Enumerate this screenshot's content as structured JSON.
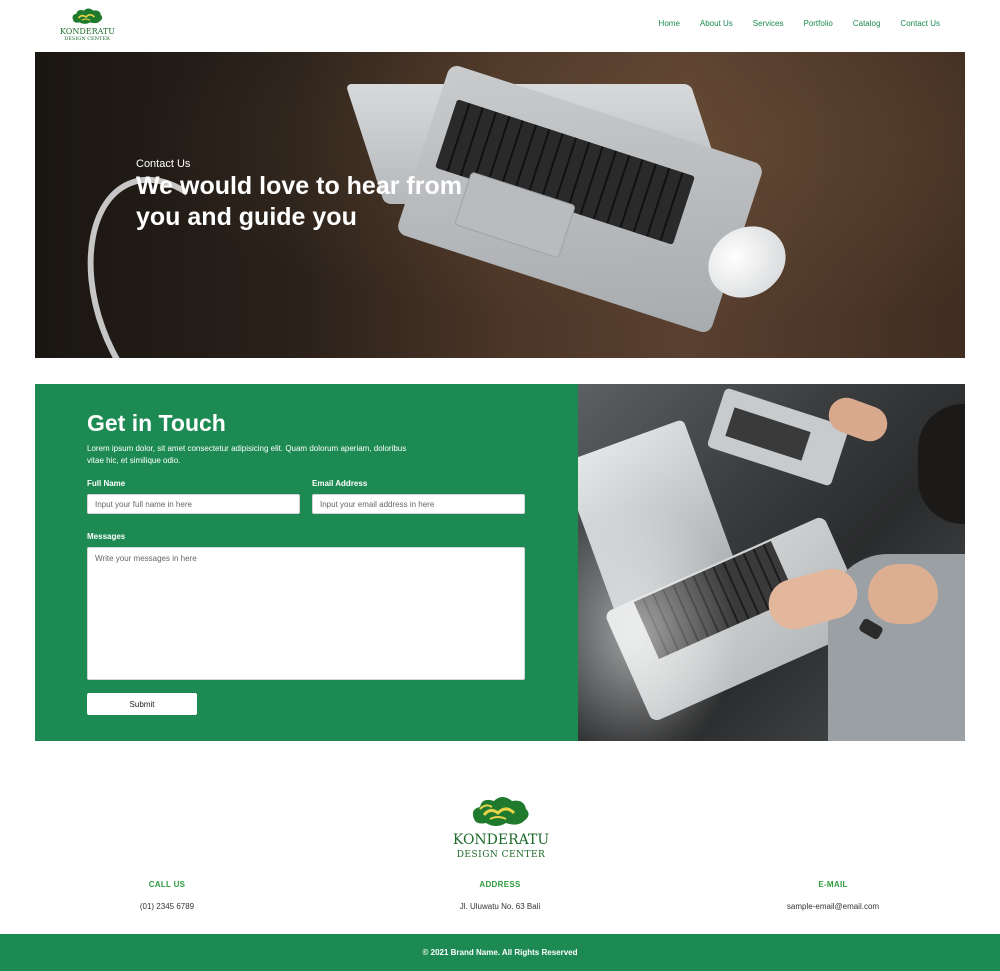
{
  "brand": {
    "name": "KONDERATU",
    "subtitle": "DESIGN CENTER",
    "color": "#1d6b2a"
  },
  "nav": {
    "items": [
      {
        "label": "Home"
      },
      {
        "label": "About Us"
      },
      {
        "label": "Services"
      },
      {
        "label": "Portfolio"
      },
      {
        "label": "Catalog"
      },
      {
        "label": "Contact Us"
      }
    ]
  },
  "hero": {
    "kicker": "Contact Us",
    "title": "We would love to hear from you and guide you"
  },
  "contact": {
    "heading": "Get in Touch",
    "description": "Lorem ipsum dolor, sit amet consectetur adipisicing elit. Quam dolorum aperiam, doloribus vitae hic, et similique odio.",
    "full_name_label": "Full Name",
    "full_name_placeholder": "Input your full name in here",
    "email_label": "Email Address",
    "email_placeholder": "Input your email address in here",
    "messages_label": "Messages",
    "messages_placeholder": "Write your messages in here",
    "submit_label": "Submit",
    "accent_color": "#1c8a52"
  },
  "footer": {
    "call": {
      "title": "CALL US",
      "value": "(01) 2345 6789"
    },
    "address": {
      "title": "ADDRESS",
      "value": "Jl. Uluwatu No. 63 Bali"
    },
    "email": {
      "title": "E-MAIL",
      "value": "sample-email@email.com"
    },
    "copyright": "© 2021 Brand Name. All Rights Reserved"
  }
}
